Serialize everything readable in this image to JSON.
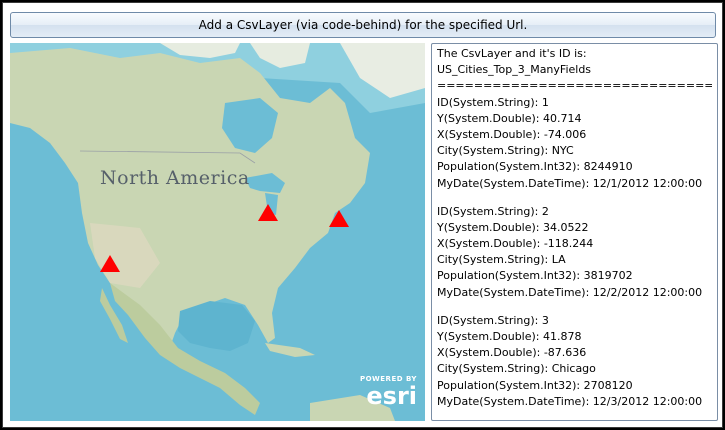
{
  "toolbar": {
    "button_label": "Add a CsvLayer (via code-behind) for the specified Url."
  },
  "map": {
    "label": "North America",
    "attribution_powered": "POWERED BY",
    "attribution_brand": "esri",
    "marker_color": "#ff0000",
    "water_color": "#6dbfd6",
    "land_color": "#c7d3b1"
  },
  "info": {
    "header_line1": "The CsvLayer and it's ID is:",
    "header_line2": "US_Cities_Top_3_ManyFields",
    "separator": "================================",
    "records": [
      {
        "id": "ID(System.String): 1",
        "y": "Y(System.Double): 40.714",
        "x": "X(System.Double): -74.006",
        "city": "City(System.String): NYC",
        "population": "Population(System.Int32): 8244910",
        "date": "MyDate(System.DateTime): 12/1/2012 12:00:00"
      },
      {
        "id": "ID(System.String): 2",
        "y": "Y(System.Double): 34.0522",
        "x": "X(System.Double): -118.244",
        "city": "City(System.String): LA",
        "population": "Population(System.Int32): 3819702",
        "date": "MyDate(System.DateTime): 12/2/2012 12:00:00"
      },
      {
        "id": "ID(System.String): 3",
        "y": "Y(System.Double): 41.878",
        "x": "X(System.Double): -87.636",
        "city": "City(System.String): Chicago",
        "population": "Population(System.Int32): 2708120",
        "date": "MyDate(System.DateTime): 12/3/2012 12:00:00"
      }
    ]
  }
}
